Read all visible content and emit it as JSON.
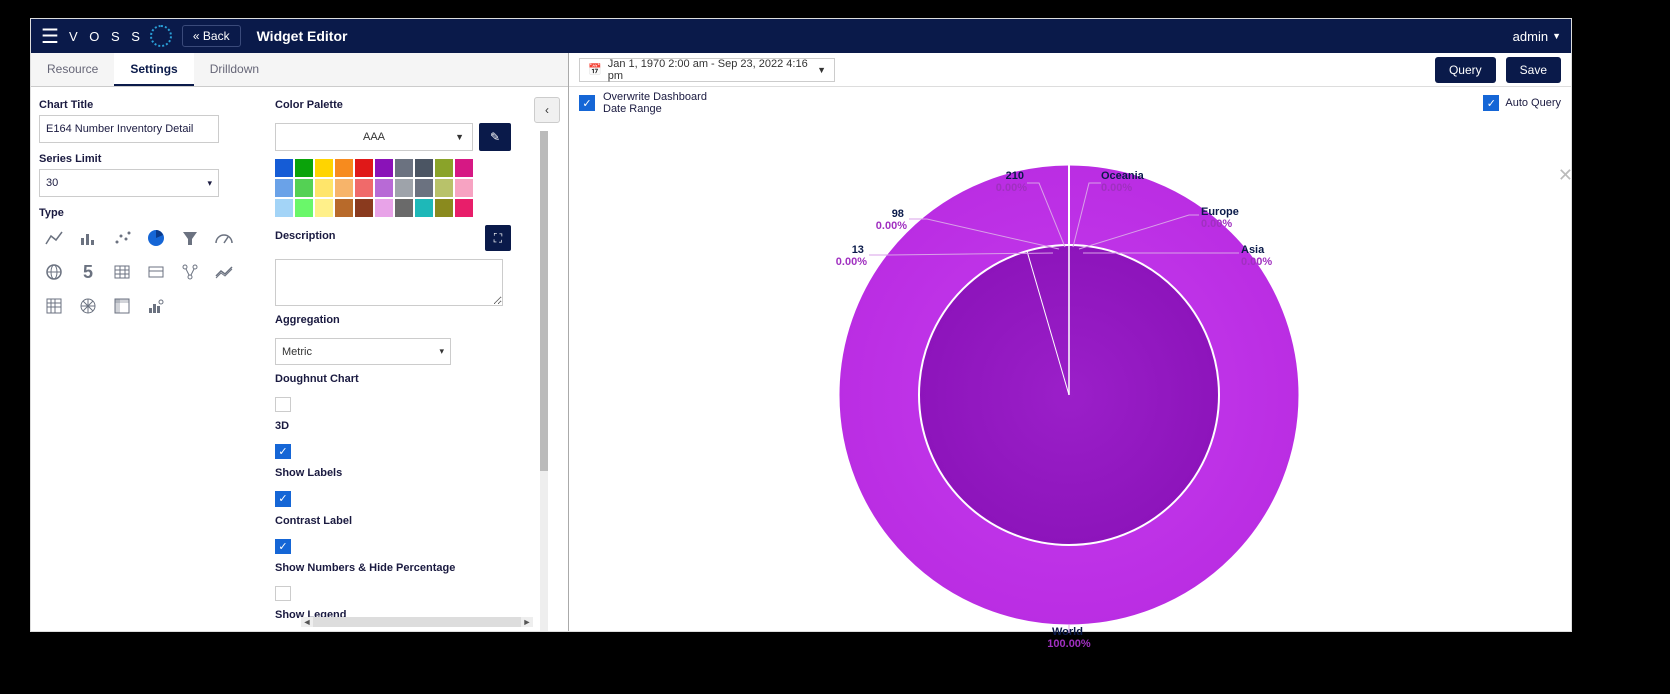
{
  "header": {
    "brand": "V O S S",
    "back_label": "« Back",
    "title": "Widget Editor",
    "user": "admin"
  },
  "tabs": {
    "resource": "Resource",
    "settings": "Settings",
    "drilldown": "Drilldown"
  },
  "settings": {
    "chart_title_label": "Chart Title",
    "chart_title_value": "E164 Number Inventory Detail",
    "series_limit_label": "Series Limit",
    "series_limit_value": "30",
    "type_label": "Type",
    "palette_label": "Color Palette",
    "palette_value": "AAA",
    "colors": [
      "#155cd6",
      "#0aa30a",
      "#ffd400",
      "#f78b1e",
      "#e01818",
      "#8a12b8",
      "#6b7280",
      "#4b5563",
      "#8aa329",
      "#d61884",
      "#6aa2e8",
      "#54d154",
      "#ffe56a",
      "#f7b46a",
      "#f06a6a",
      "#b86ad6",
      "#9ea3aa",
      "#6b7280",
      "#b8c26a",
      "#f7a3c2",
      "#a3d4f7",
      "#6af76a",
      "#fff08a",
      "#b86a2a",
      "#8a3a1e",
      "#e8a3e8",
      "#6a6a6a",
      "#1eb8b8",
      "#8a8a1e",
      "#e81e6a"
    ],
    "description_label": "Description",
    "description_value": "",
    "aggregation_label": "Aggregation",
    "aggregation_value": "Metric",
    "doughnut_label": "Doughnut Chart",
    "doughnut_checked": false,
    "three_d_label": "3D",
    "three_d_checked": true,
    "show_labels_label": "Show Labels",
    "show_labels_checked": true,
    "contrast_label": "Contrast Label",
    "contrast_checked": true,
    "show_numbers_label": "Show Numbers & Hide Percentage",
    "show_numbers_checked": false,
    "show_legend_label": "Show Legend"
  },
  "right": {
    "date_range": "Jan 1, 1970 2:00 am - Sep 23, 2022 4:16 pm",
    "query_label": "Query",
    "save_label": "Save",
    "overwrite_label_line1": "Overwrite Dashboard",
    "overwrite_label_line2": "Date Range",
    "overwrite_checked": true,
    "auto_query_label": "Auto Query",
    "auto_query_checked": true
  },
  "chart_data": {
    "type": "pie",
    "title": "E164 Number Inventory Detail",
    "nested": true,
    "outer": {
      "series_name": "World",
      "slices": [
        {
          "label": "World",
          "value": 100.0,
          "unit": "%",
          "display": "100.00%"
        }
      ]
    },
    "inner": {
      "slices": [
        {
          "label": "210",
          "value": 0.0,
          "unit": "%",
          "display": "0.00%"
        },
        {
          "label": "Oceania",
          "value": 0.0,
          "unit": "%",
          "display": "0.00%"
        },
        {
          "label": "Europe",
          "value": 0.0,
          "unit": "%",
          "display": "0.00%"
        },
        {
          "label": "Asia",
          "value": 0.0,
          "unit": "%",
          "display": "0.00%"
        },
        {
          "label": "98",
          "value": 0.0,
          "unit": "%",
          "display": "0.00%"
        },
        {
          "label": "13",
          "value": 0.0,
          "unit": "%",
          "display": "0.00%"
        }
      ]
    }
  }
}
